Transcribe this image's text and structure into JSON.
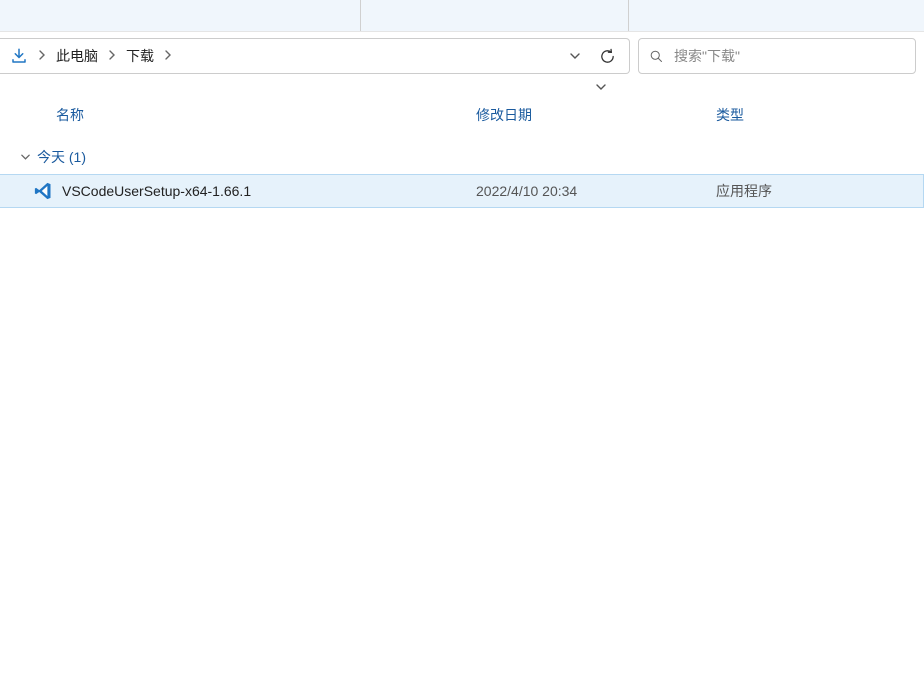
{
  "breadcrumb": {
    "items": [
      "此电脑",
      "下载"
    ]
  },
  "search": {
    "placeholder": "搜索\"下载\""
  },
  "columns": {
    "name": "名称",
    "date": "修改日期",
    "type": "类型"
  },
  "group": {
    "label": "今天 (1)"
  },
  "files": [
    {
      "name": "VSCodeUserSetup-x64-1.66.1",
      "date": "2022/4/10 20:34",
      "type": "应用程序",
      "icon": "vscode"
    }
  ]
}
